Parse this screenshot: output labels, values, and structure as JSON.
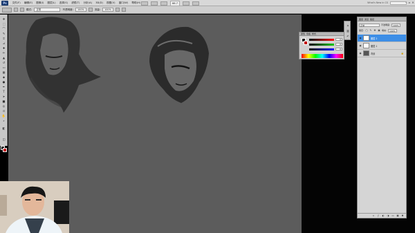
{
  "menubar": {
    "logo": "Ps",
    "items": [
      "文件(F)",
      "编辑(E)",
      "图像(I)",
      "图层(L)",
      "选择(S)",
      "滤镜(T)",
      "分析(A)",
      "3D(D)",
      "视图(V)",
      "窗口(W)",
      "帮助(H)"
    ],
    "zoom": "66.7",
    "workspace_label": "What's New in CS",
    "window_buttons": [
      "–",
      "▫",
      "×"
    ]
  },
  "options": {
    "mode_label": "模式:",
    "mode_value": "正常",
    "opacity_label": "不透明度:",
    "opacity_value": "100%",
    "flow_label": "流量:",
    "flow_value": "100%"
  },
  "color_panel": {
    "tabs": [
      "颜色",
      "色板",
      "样式"
    ],
    "r": "0",
    "g": "0",
    "b": "0"
  },
  "layers_panel": {
    "tabs": [
      "图层",
      "通道",
      "路径"
    ],
    "blend_mode": "正常",
    "opacity_label": "不透明度:",
    "opacity_value": "100%",
    "lock_label": "锁定:",
    "fill_label": "填充:",
    "fill_value": "100%",
    "layers": [
      {
        "name": "图层 2",
        "active": true
      },
      {
        "name": "图层 1",
        "active": false
      },
      {
        "name": "背景",
        "active": false
      }
    ]
  },
  "colors": {
    "accent": "#3d8ee6",
    "canvas": "#5c5c5c",
    "foreground": "#1a1a1a",
    "background": "#c41414"
  }
}
